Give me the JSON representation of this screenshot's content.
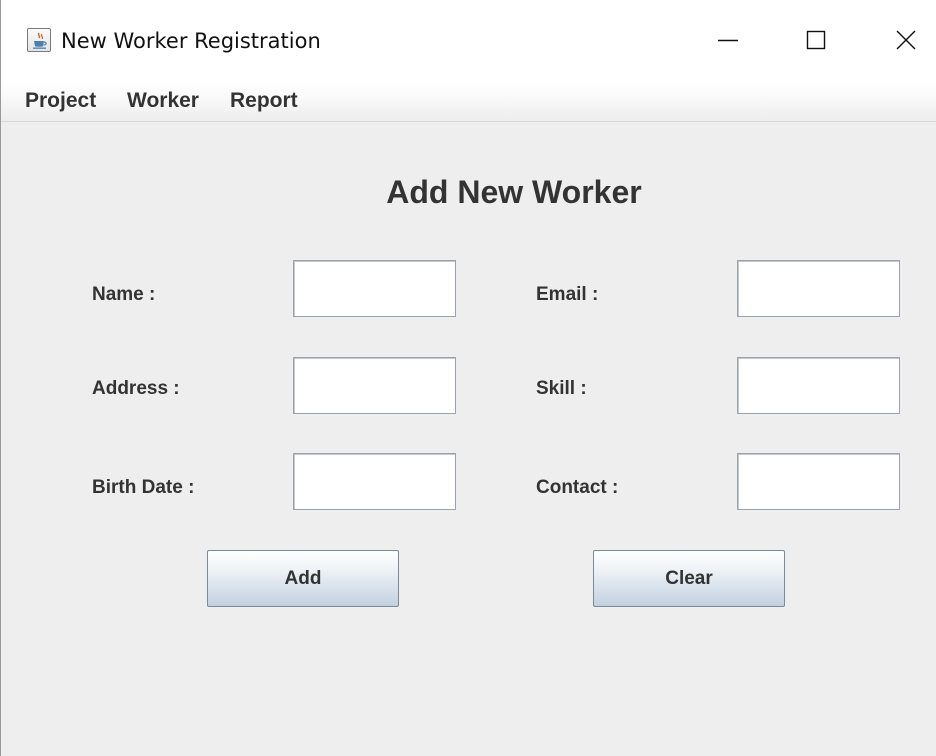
{
  "window": {
    "title": "New Worker Registration",
    "icons": {
      "app": "java-cup-icon",
      "minimize": "minimize-icon",
      "maximize": "maximize-icon",
      "close": "close-icon"
    }
  },
  "menu": {
    "items": [
      {
        "label": "Project"
      },
      {
        "label": "Worker"
      },
      {
        "label": "Report"
      }
    ]
  },
  "form": {
    "heading": "Add New Worker",
    "fields": {
      "name": {
        "label": "Name :",
        "value": ""
      },
      "address": {
        "label": "Address :",
        "value": ""
      },
      "birth_date": {
        "label": "Birth Date :",
        "value": ""
      },
      "email": {
        "label": "Email :",
        "value": ""
      },
      "skill": {
        "label": "Skill :",
        "value": ""
      },
      "contact": {
        "label": "Contact :",
        "value": ""
      }
    },
    "buttons": {
      "add": "Add",
      "clear": "Clear"
    }
  },
  "colors": {
    "window_background": "#eeeeee",
    "text": "#333333",
    "button_gradient_top": "#ffffff",
    "button_gradient_bottom": "#c2d0de",
    "button_border": "#7a8a99"
  }
}
